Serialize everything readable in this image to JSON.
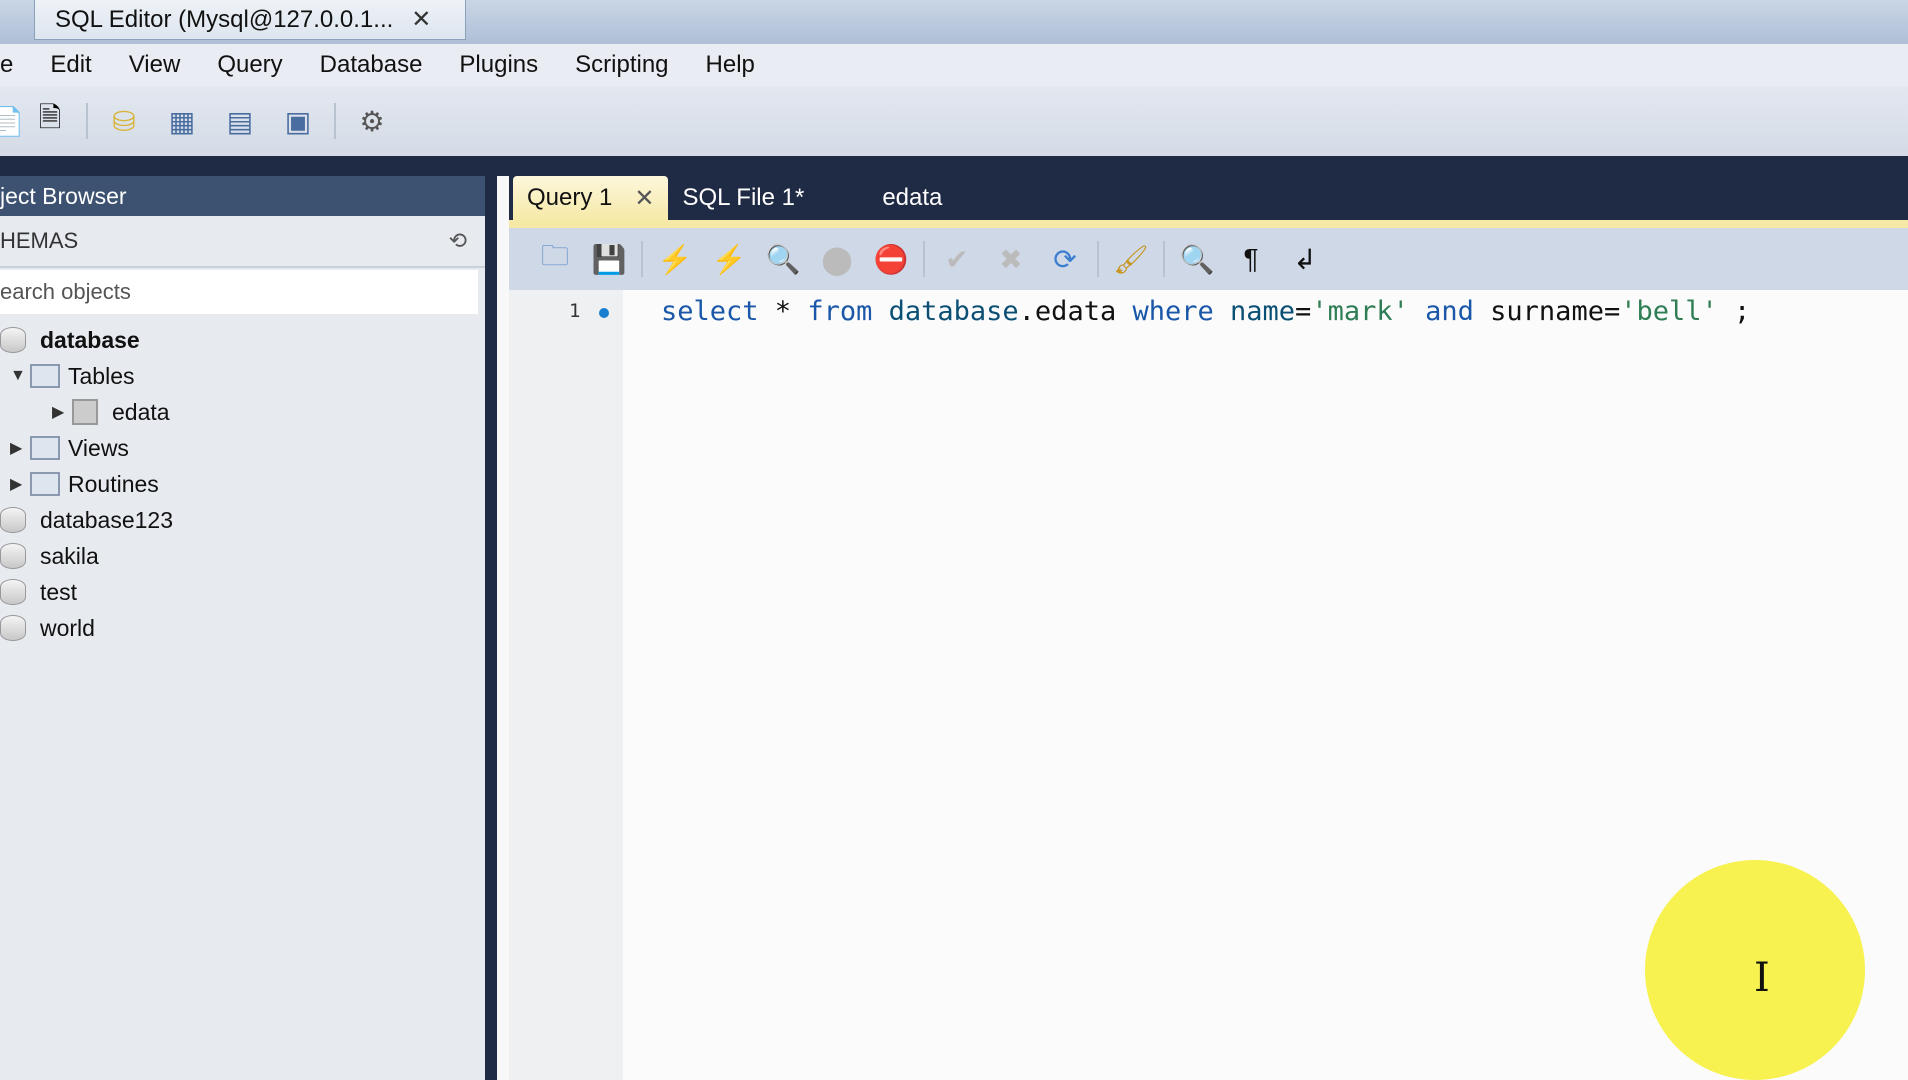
{
  "window": {
    "tab_title": "SQL Editor (Mysql@127.0.0.1...",
    "close": "✕"
  },
  "menu": [
    "e",
    "Edit",
    "View",
    "Query",
    "Database",
    "Plugins",
    "Scripting",
    "Help"
  ],
  "left": {
    "header": "ject Browser",
    "schemas": "HEMAS",
    "search_placeholder": "earch objects",
    "tree": [
      {
        "label": "database",
        "type": "db"
      },
      {
        "label": "Tables",
        "type": "folder"
      },
      {
        "label": "edata",
        "type": "table"
      },
      {
        "label": "Views",
        "type": "folder"
      },
      {
        "label": "Routines",
        "type": "folder"
      },
      {
        "label": "database123",
        "type": "db"
      },
      {
        "label": "sakila",
        "type": "db"
      },
      {
        "label": "test",
        "type": "db"
      },
      {
        "label": "world",
        "type": "db"
      }
    ]
  },
  "tabs": [
    {
      "label": "Query 1",
      "close": "✕"
    },
    {
      "label": "SQL File 1*"
    },
    {
      "label": "edata"
    }
  ],
  "editor": {
    "line_number": "1",
    "code": {
      "k1": "select",
      "p1": " * ",
      "k2": "from",
      "p2": " ",
      "t": "database",
      "p3": ".edata ",
      "k3": "where",
      "p4": " ",
      "c1": "name",
      "p5": "=",
      "s1": "'mark'",
      "p6": " ",
      "k4": "and",
      "p7": " surname=",
      "s2": "'bell'",
      "p8": " ;"
    }
  },
  "cursor": "I"
}
